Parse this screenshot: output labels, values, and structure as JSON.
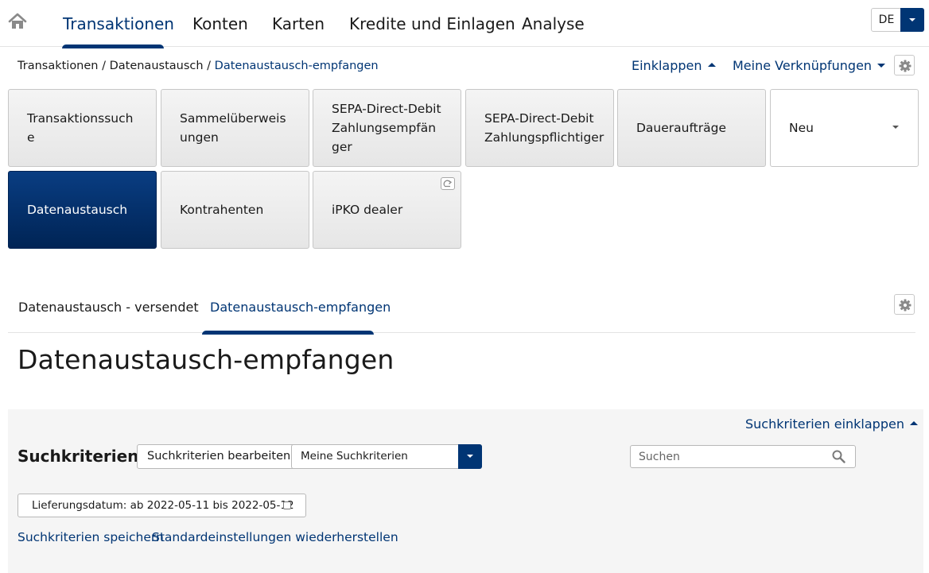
{
  "nav": {
    "items": [
      "Transaktionen",
      "Konten",
      "Karten",
      "Kredite und Einlagen",
      "Analyse"
    ],
    "language": "DE"
  },
  "breadcrumb": {
    "path": "Transaktionen / Datenaustausch / ",
    "current": "Datenaustausch-empfangen"
  },
  "toolbar": {
    "collapse": "Einklappen",
    "shortcuts": "Meine Verknüpfungen"
  },
  "tiles": {
    "row1": [
      "Transaktionssuche",
      "Sammelüberweisungen",
      "SEPA-Direct-Debit Zahlungsempfänger",
      "SEPA-Direct-Debit Zahlungspflichtiger",
      "Daueraufträge",
      "Neu"
    ],
    "row2": [
      "Datenaustausch",
      "Kontrahenten",
      "iPKO dealer"
    ]
  },
  "subtabs": [
    "Datenaustausch - versendet",
    "Datenaustausch-empfangen"
  ],
  "page_title": "Datenaustausch-empfangen",
  "search": {
    "collapse_label": "Suchkriterien einklappen",
    "title": "Suchkriterien",
    "edit_button": "Suchkriterien bearbeiten",
    "saved_criteria": "Meine Suchkriterien",
    "search_placeholder": "Suchen",
    "filter_chip": "Lieferungsdatum: ab 2022-05-11 bis 2022-05-12",
    "save_link": "Suchkriterien speichern",
    "reset_link": "Standardeinstellungen wiederherstellen"
  },
  "colors": {
    "primary": "#003574",
    "panel_bg": "#f5f5f5",
    "tile_bg": "#ececec"
  }
}
